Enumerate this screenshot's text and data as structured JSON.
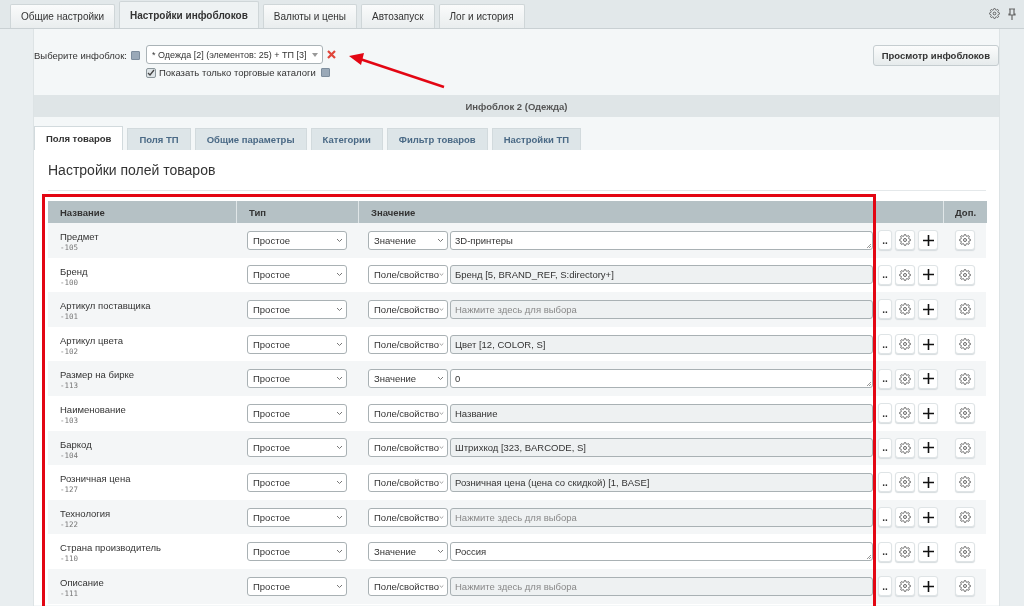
{
  "top_tabs": [
    {
      "label": "Общие настройки",
      "selected": false
    },
    {
      "label": "Настройки инфоблоков",
      "selected": true
    },
    {
      "label": "Валюты и цены",
      "selected": false
    },
    {
      "label": "Автозапуск",
      "selected": false
    },
    {
      "label": "Лог и история",
      "selected": false
    }
  ],
  "selector": {
    "label": "Выберите инфоблок:",
    "value": "* Одежда [2] (элементов: 25) + ТП [3]",
    "checkbox": {
      "label": "Показать только торговые каталоги",
      "checked": true
    }
  },
  "view_button": "Просмотр инфоблоков",
  "infoblock_title": "Инфоблок 2 (Одежда)",
  "sub_tabs": [
    {
      "label": "Поля товаров",
      "selected": true
    },
    {
      "label": "Поля ТП",
      "selected": false
    },
    {
      "label": "Общие параметры",
      "selected": false
    },
    {
      "label": "Категории",
      "selected": false
    },
    {
      "label": "Фильтр товаров",
      "selected": false
    },
    {
      "label": "Настройки ТП",
      "selected": false
    }
  ],
  "section_title": "Настройки полей товаров",
  "table": {
    "columns": [
      "Название",
      "Тип",
      "Значение",
      "Доп."
    ],
    "rows": [
      {
        "name": "Предмет",
        "code": "-105",
        "type": "Простое",
        "source": "Значение",
        "kind": "value",
        "value": "3D-принтеры",
        "more": ".."
      },
      {
        "name": "Бренд",
        "code": "-100",
        "type": "Простое",
        "source": "Поле/свойство",
        "kind": "property",
        "value": "Бренд [5, BRAND_REF, S:directory+]",
        "more": ".."
      },
      {
        "name": "Артикул поставщика",
        "code": "-101",
        "type": "Простое",
        "source": "Поле/свойство",
        "kind": "property",
        "placeholder": "Нажмите здесь для выбора",
        "more": ".."
      },
      {
        "name": "Артикул цвета",
        "code": "-102",
        "type": "Простое",
        "source": "Поле/свойство",
        "kind": "property",
        "value": "Цвет [12, COLOR, S]",
        "more": ".."
      },
      {
        "name": "Размер на бирке",
        "code": "-113",
        "type": "Простое",
        "source": "Значение",
        "kind": "value",
        "value": "0",
        "more": ".."
      },
      {
        "name": "Наименование",
        "code": "-103",
        "type": "Простое",
        "source": "Поле/свойство",
        "kind": "property",
        "value": "Название",
        "more": ".."
      },
      {
        "name": "Баркод",
        "code": "-104",
        "type": "Простое",
        "source": "Поле/свойство",
        "kind": "property",
        "value": "Штрихкод [323, BARCODE, S]",
        "more": ".."
      },
      {
        "name": "Розничная цена",
        "code": "-127",
        "type": "Простое",
        "source": "Поле/свойство",
        "kind": "property",
        "value": "Розничная цена (цена со скидкой) [1, BASE]",
        "more": ".."
      },
      {
        "name": "Технология",
        "code": "-122",
        "type": "Простое",
        "source": "Поле/свойство",
        "kind": "property",
        "placeholder": "Нажмите здесь для выбора",
        "more": ".."
      },
      {
        "name": "Страна производитель",
        "code": "-110",
        "type": "Простое",
        "source": "Значение",
        "kind": "value",
        "value": "Россия",
        "more": ".."
      },
      {
        "name": "Описание",
        "code": "-111",
        "type": "Простое",
        "source": "Поле/свойство",
        "kind": "property",
        "placeholder": "Нажмите здесь для выбора",
        "more": ".."
      }
    ]
  }
}
